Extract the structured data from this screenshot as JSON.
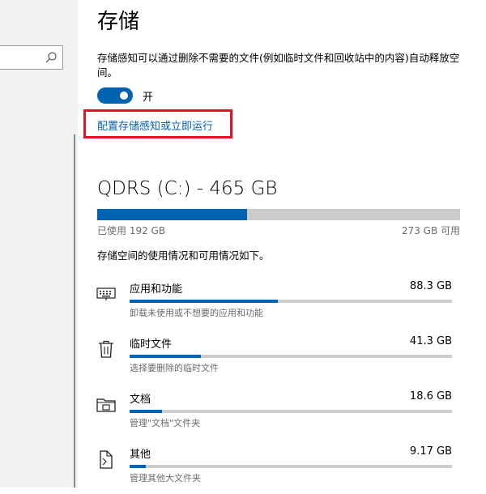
{
  "page_title": "存储",
  "storage_sense": {
    "description": "存储感知可以通过删除不需要的文件(例如临时文件和回收站中的内容)自动释放空间。",
    "toggle_state": "开",
    "toggle_on": true,
    "configure_link": "配置存储感知或立即运行"
  },
  "drive": {
    "title": "QDRS (C:) - 465 GB",
    "used_label": "已使用 192 GB",
    "free_label": "273 GB 可用",
    "used_fraction": 0.413
  },
  "usage_caption": "存储空间的使用情况和可用情况如下。",
  "categories": [
    {
      "name": "应用和功能",
      "size": "88.3 GB",
      "sub": "卸载未使用或不想要的应用和功能",
      "fraction": 0.46,
      "icon": "keyboard-icon"
    },
    {
      "name": "临时文件",
      "size": "41.3 GB",
      "sub": "选择要删除的临时文件",
      "fraction": 0.22,
      "icon": "trash-icon"
    },
    {
      "name": "文档",
      "size": "18.6 GB",
      "sub": "管理\"文档\"文件夹",
      "fraction": 0.1,
      "icon": "folder-icon"
    },
    {
      "name": "其他",
      "size": "9.17 GB",
      "sub": "管理其他大文件夹",
      "fraction": 0.05,
      "icon": "document-icon"
    }
  ],
  "colors": {
    "accent": "#0063b1",
    "highlight_border": "#e81123",
    "link": "#005fb7"
  }
}
